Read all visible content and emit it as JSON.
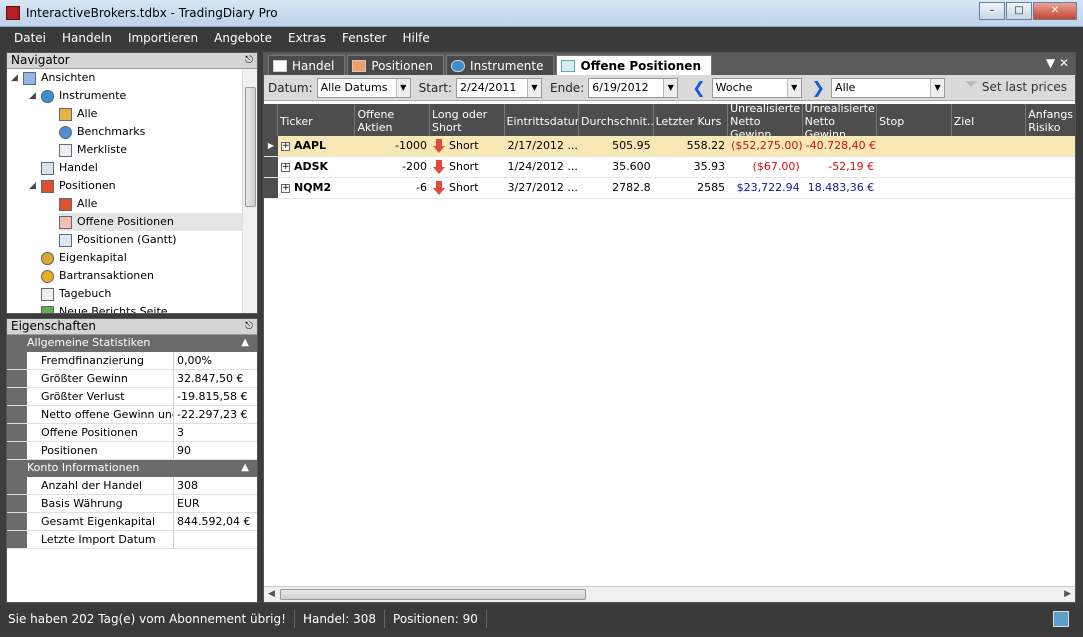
{
  "window": {
    "title": "InteractiveBrokers.tdbx - TradingDiary Pro"
  },
  "menu": [
    "Datei",
    "Handeln",
    "Importieren",
    "Angebote",
    "Extras",
    "Fenster",
    "Hilfe"
  ],
  "navigator": {
    "title": "Navigator",
    "items": [
      "Ansichten",
      "Instrumente",
      "Alle",
      "Benchmarks",
      "Merkliste",
      "Handel",
      "Positionen",
      "Alle",
      "Offene Positionen",
      "Positionen (Gantt)",
      "Eigenkapital",
      "Bartransaktionen",
      "Tagebuch",
      "Neue Berichts Seite"
    ]
  },
  "properties": {
    "title": "Eigenschaften",
    "group1": {
      "title": "Allgemeine Statistiken",
      "rows": [
        {
          "name": "Fremdfinanzierung",
          "value": "0,00%"
        },
        {
          "name": "Größter Gewinn",
          "value": "32.847,50 €"
        },
        {
          "name": "Größter Verlust",
          "value": "-19.815,58 €"
        },
        {
          "name": "Netto offene Gewinn und V",
          "value": "-22.297,23 €"
        },
        {
          "name": "Offene Positionen",
          "value": "3"
        },
        {
          "name": "Positionen",
          "value": "90"
        }
      ]
    },
    "group2": {
      "title": "Konto Informationen",
      "rows": [
        {
          "name": "Anzahl der Handel",
          "value": "308"
        },
        {
          "name": "Basis Währung",
          "value": "EUR"
        },
        {
          "name": "Gesamt Eigenkapital",
          "value": "844.592,04 €"
        },
        {
          "name": "Letzte Import Datum",
          "value": ""
        }
      ]
    }
  },
  "tabs": [
    "Handel",
    "Positionen",
    "Instrumente",
    "Offene Positionen"
  ],
  "toolbar": {
    "datum_label": "Datum:",
    "datum_value": "Alle Datums",
    "start_label": "Start:",
    "start_value": "2/24/2011",
    "ende_label": "Ende:",
    "ende_value": "6/19/2012",
    "period_value": "Woche",
    "filter_value": "Alle",
    "set_last_prices": "Set last prices"
  },
  "grid": {
    "headers": [
      "Ticker",
      "Offene Aktien",
      "Long oder Short",
      "Eintrittsdatum",
      "Durchschnit...",
      "Letzter Kurs",
      "Unrealisierte Netto Gewinn",
      "Unrealisierte Netto Gewinn",
      "Stop",
      "Ziel",
      "Anfangs Risiko"
    ],
    "rows": [
      {
        "ticker": "AAPL",
        "shares": "-1000",
        "side": "Short",
        "entry": "2/17/2012 ...",
        "avg": "505.95",
        "last": "558.22",
        "usd": "($52,275.00)",
        "eur": "-40.728,40 €"
      },
      {
        "ticker": "ADSK",
        "shares": "-200",
        "side": "Short",
        "entry": "1/24/2012 ...",
        "avg": "35.600",
        "last": "35.93",
        "usd": "($67.00)",
        "eur": "-52,19 €"
      },
      {
        "ticker": "NQM2",
        "shares": "-6",
        "side": "Short",
        "entry": "3/27/2012 ...",
        "avg": "2782.8",
        "last": "2585",
        "usd": "$23,722.94",
        "eur": "18.483,36 €"
      }
    ]
  },
  "status": {
    "subscription": "Sie haben 202 Tag(e) vom Abonnement übrig!",
    "handel": "Handel: 308",
    "positionen": "Positionen: 90"
  }
}
